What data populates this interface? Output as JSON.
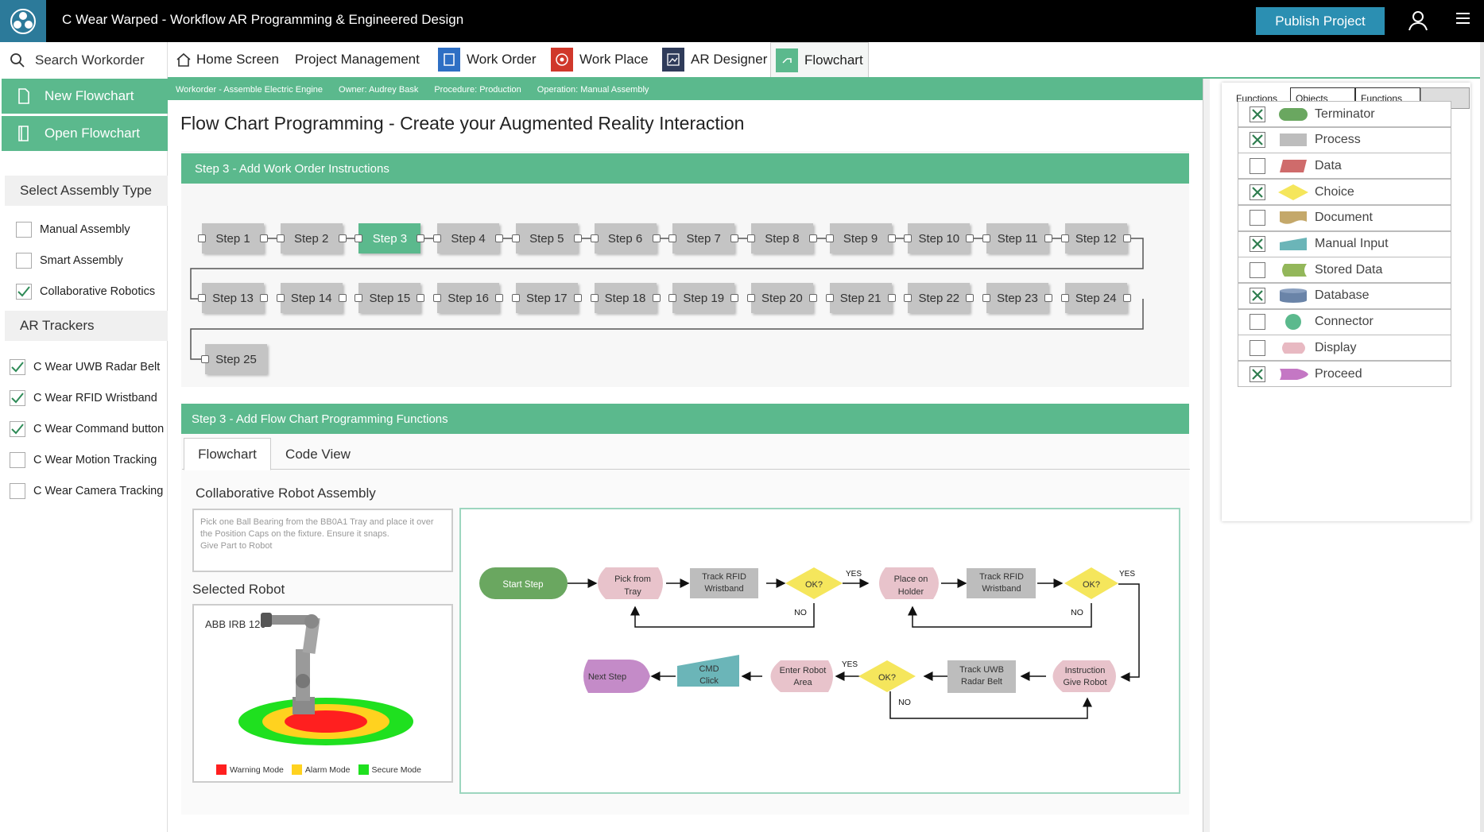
{
  "app": {
    "title": "C Wear Warped - Workflow AR Programming & Engineered Design",
    "publish_label": "Publish Project"
  },
  "nav": {
    "tabs": [
      {
        "label": "Home Screen"
      },
      {
        "label": "Project Management"
      },
      {
        "label": "Work Order"
      },
      {
        "label": "Work Place"
      },
      {
        "label": "AR Designer"
      },
      {
        "label": "Flowchart",
        "active": true
      }
    ]
  },
  "sidebar": {
    "search_label": "Search Workorder",
    "new_flowchart": "New Flowchart",
    "open_flowchart": "Open Flowchart",
    "assembly_heading": "Select Assembly Type",
    "assembly_types": [
      {
        "label": "Manual Assembly",
        "checked": false
      },
      {
        "label": "Smart Assembly",
        "checked": false
      },
      {
        "label": "Collaborative Robotics",
        "checked": true
      }
    ],
    "trackers_heading": "AR Trackers",
    "trackers": [
      {
        "label": "C Wear UWB Radar Belt",
        "checked": true
      },
      {
        "label": "C Wear RFID Wristband",
        "checked": true
      },
      {
        "label": "C Wear Command button",
        "checked": true
      },
      {
        "label": "C Wear Motion Tracking",
        "checked": false
      },
      {
        "label": "C Wear Camera Tracking",
        "checked": false
      }
    ]
  },
  "infobar": {
    "workorder": "Workorder - Assemble Electric Engine",
    "owner": "Owner: Audrey Bask",
    "procedure": "Procedure: Production",
    "operation": "Operation: Manual Assembly"
  },
  "main": {
    "page_title": "Flow Chart Programming - Create your Augmented Reality Interaction",
    "step3_heading": "Step 3 - Add Work Order Instructions",
    "steps": [
      "Step 1",
      "Step 2",
      "Step 3",
      "Step 4",
      "Step 5",
      "Step 6",
      "Step 7",
      "Step 8",
      "Step 9",
      "Step 10",
      "Step 11",
      "Step 12",
      "Step 13",
      "Step 14",
      "Step 15",
      "Step 16",
      "Step 17",
      "Step 18",
      "Step 19",
      "Step 20",
      "Step 21",
      "Step 22",
      "Step 23",
      "Step 24",
      "Step 25"
    ],
    "selected_step": "Step 3",
    "functions_heading": "Step 3 - Add Flow Chart Programming Functions",
    "tabs": [
      {
        "label": "Flowchart",
        "active": true
      },
      {
        "label": "Code View"
      }
    ],
    "assembly_title": "Collaborative Robot Assembly",
    "instructions": "Pick one Ball Bearing from the BB0A1 Tray and place it over the Position Caps on the fixture. Ensure it snaps.\nGive Part to Robot",
    "selected_robot_label": "Selected Robot",
    "robot_name": "ABB IRB 120",
    "legend": [
      {
        "label": "Warning Mode",
        "color": "#ff1f1f"
      },
      {
        "label": "Alarm Mode",
        "color": "#ffd21f"
      },
      {
        "label": "Secure Mode",
        "color": "#1fe01f"
      }
    ]
  },
  "flowchart": {
    "nodes": {
      "start": "Start Step",
      "pick": [
        "Pick from",
        "Tray"
      ],
      "track1": [
        "Track RFID",
        "Wristband"
      ],
      "ok": "OK?",
      "place": [
        "Place on",
        "Holder"
      ],
      "track2": [
        "Track RFID",
        "Wristband"
      ],
      "instruction": [
        "Instruction",
        "Give Robot"
      ],
      "track_uwb": [
        "Track UWB",
        "Radar Belt"
      ],
      "enter": [
        "Enter Robot",
        "Area"
      ],
      "cmd": [
        "CMD",
        "Click"
      ],
      "next": "Next Step"
    },
    "yes": "YES",
    "no": "NO"
  },
  "right_panel": {
    "tabs": [
      "Functions",
      "Objects",
      "Functions",
      ""
    ],
    "functions": [
      {
        "label": "Terminator",
        "checked": true,
        "color": "#6aa760",
        "shape": "pill"
      },
      {
        "label": "Process",
        "checked": true,
        "color": "#bdbdbd",
        "shape": "rect"
      },
      {
        "label": "Data",
        "checked": false,
        "color": "#cf6b6b",
        "shape": "parallelogram"
      },
      {
        "label": "Choice",
        "checked": true,
        "color": "#f5e65c",
        "shape": "diamond"
      },
      {
        "label": "Document",
        "checked": false,
        "color": "#c4a86a",
        "shape": "document"
      },
      {
        "label": "Manual Input",
        "checked": true,
        "color": "#6bb5b8",
        "shape": "manual"
      },
      {
        "label": "Stored Data",
        "checked": false,
        "color": "#93b75a",
        "shape": "stored"
      },
      {
        "label": "Database",
        "checked": true,
        "color": "#6a84a8",
        "shape": "cylinder"
      },
      {
        "label": "Connector",
        "checked": false,
        "color": "#5bb98d",
        "shape": "circle"
      },
      {
        "label": "Display",
        "checked": false,
        "color": "#e8b9c2",
        "shape": "display"
      },
      {
        "label": "Proceed",
        "checked": true,
        "color": "#c477c4",
        "shape": "proceed"
      }
    ]
  }
}
